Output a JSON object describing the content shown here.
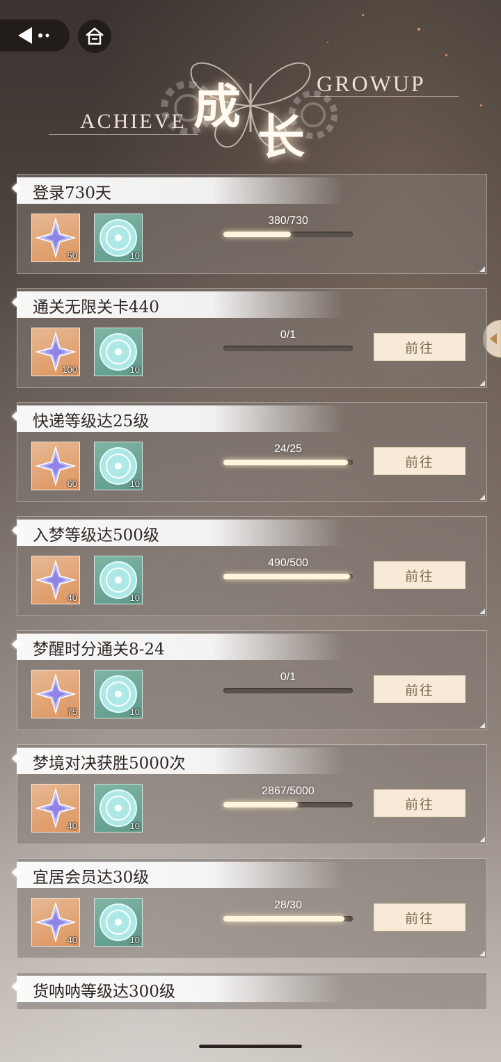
{
  "header": {
    "left_word": "ACHIEVE",
    "right_word": "GROWUP",
    "char1": "成",
    "char2": "长"
  },
  "action_label": "前往",
  "tasks": [
    {
      "title": "登录730天",
      "rewards": [
        {
          "icon": "star-crystal-icon",
          "qty": "50"
        },
        {
          "icon": "silver-coin-icon",
          "qty": "10"
        }
      ],
      "progress_text": "380/730",
      "progress": 0.52,
      "has_button": false
    },
    {
      "title": "通关无限关卡440",
      "rewards": [
        {
          "icon": "star-crystal-icon",
          "qty": "100"
        },
        {
          "icon": "silver-coin-icon",
          "qty": "10"
        }
      ],
      "progress_text": "0/1",
      "progress": 0.0,
      "has_button": true
    },
    {
      "title": "快递等级达25级",
      "rewards": [
        {
          "icon": "star-crystal-icon",
          "qty": "60"
        },
        {
          "icon": "silver-coin-icon",
          "qty": "10"
        }
      ],
      "progress_text": "24/25",
      "progress": 0.96,
      "has_button": true
    },
    {
      "title": "入梦等级达500级",
      "rewards": [
        {
          "icon": "star-crystal-icon",
          "qty": "40"
        },
        {
          "icon": "silver-coin-icon",
          "qty": "10"
        }
      ],
      "progress_text": "490/500",
      "progress": 0.98,
      "has_button": true
    },
    {
      "title": "梦醒时分通关8-24",
      "rewards": [
        {
          "icon": "star-crystal-icon",
          "qty": "75"
        },
        {
          "icon": "silver-coin-icon",
          "qty": "10"
        }
      ],
      "progress_text": "0/1",
      "progress": 0.0,
      "has_button": true
    },
    {
      "title": "梦境对决获胜5000次",
      "rewards": [
        {
          "icon": "star-crystal-icon",
          "qty": "40"
        },
        {
          "icon": "silver-coin-icon",
          "qty": "10"
        }
      ],
      "progress_text": "2867/5000",
      "progress": 0.5734,
      "has_button": true
    },
    {
      "title": "宜居会员达30级",
      "rewards": [
        {
          "icon": "star-crystal-icon",
          "qty": "40"
        },
        {
          "icon": "silver-coin-icon",
          "qty": "10"
        }
      ],
      "progress_text": "28/30",
      "progress": 0.9333,
      "has_button": true
    }
  ],
  "partial_task": {
    "title": "货呐呐等级达300级"
  },
  "colors": {
    "accent": "#fff5df",
    "button_bg": "#f7ead6",
    "button_text": "#7b6650"
  }
}
